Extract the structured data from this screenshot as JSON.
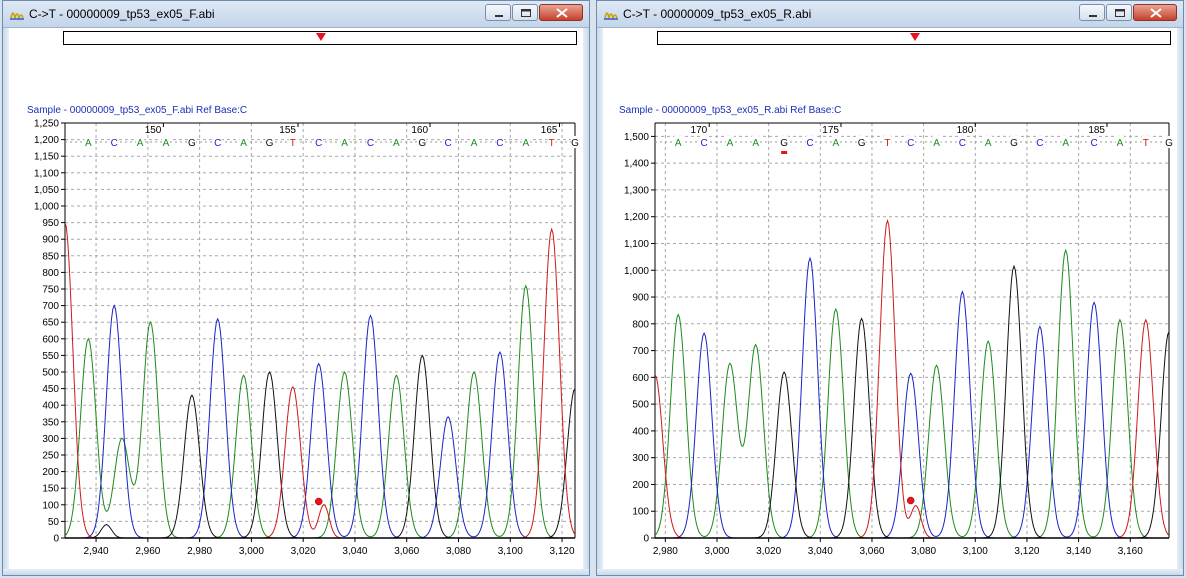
{
  "windows": [
    {
      "title": "C->T - 00000009_tp53_ex05_F.abi",
      "sample_label": "Sample - 00000009_tp53_ex05_F.abi  Ref Base:C",
      "nav_marker_fraction": 0.5,
      "chart_data": {
        "type": "line",
        "xlim": [
          2928,
          3125
        ],
        "ylim": [
          0,
          1250
        ],
        "x_ticks": [
          2940,
          2960,
          2980,
          3000,
          3020,
          3040,
          3060,
          3080,
          3100,
          3120
        ],
        "x_tick_labels": [
          "2,940",
          "2,960",
          "2,980",
          "3,000",
          "3,020",
          "3,040",
          "3,060",
          "3,080",
          "3,100",
          "3,120"
        ],
        "y_ticks": [
          0,
          50,
          100,
          150,
          200,
          250,
          300,
          350,
          400,
          450,
          500,
          550,
          600,
          650,
          700,
          750,
          800,
          850,
          900,
          950,
          1000,
          1050,
          1100,
          1150,
          1200,
          1250
        ],
        "y_tick_labels": [
          "0",
          "50",
          "100",
          "150",
          "200",
          "250",
          "300",
          "350",
          "400",
          "450",
          "500",
          "550",
          "600",
          "650",
          "700",
          "750",
          "800",
          "850",
          "900",
          "950",
          "1,000",
          "1,050",
          "1,100",
          "1,150",
          "1,200",
          "1,250"
        ],
        "bases": {
          "letters": [
            "A",
            "C",
            "A",
            "A",
            "G",
            "C",
            "A",
            "G",
            "T",
            "C",
            "A",
            "C",
            "A",
            "G",
            "C",
            "A",
            "C",
            "A",
            "T",
            "G"
          ],
          "x": [
            2937,
            2947,
            2957,
            2967,
            2977,
            2987,
            2997,
            3007,
            3016,
            3026,
            3036,
            3046,
            3056,
            3066,
            3076,
            3086,
            3096,
            3106,
            3116,
            3125
          ]
        },
        "position_labels": [
          "150",
          "155",
          "160",
          "165"
        ],
        "position_x": [
          2966,
          3018,
          3069,
          3119
        ],
        "variant_point": {
          "x": 3026,
          "y": 110
        },
        "series": [
          {
            "name": "A",
            "color": "#1e8a1e",
            "peaks": [
              [
                2937,
                600,
                3
              ],
              [
                2961,
                650,
                3
              ],
              [
                2950,
                300,
                3
              ],
              [
                2997,
                490,
                3
              ],
              [
                3036,
                500,
                3
              ],
              [
                3056,
                490,
                3
              ],
              [
                3086,
                500,
                3
              ],
              [
                3106,
                760,
                3
              ]
            ]
          },
          {
            "name": "C",
            "color": "#1a23c8",
            "peaks": [
              [
                2947,
                700,
                3
              ],
              [
                2987,
                660,
                3
              ],
              [
                3026,
                525,
                3
              ],
              [
                3046,
                670,
                3
              ],
              [
                3076,
                365,
                3
              ],
              [
                3096,
                560,
                3
              ]
            ]
          },
          {
            "name": "G",
            "color": "#111111",
            "peaks": [
              [
                2977,
                430,
                3
              ],
              [
                3007,
                500,
                3
              ],
              [
                3066,
                550,
                3
              ],
              [
                3125,
                450,
                3
              ],
              [
                2944,
                40,
                2
              ]
            ]
          },
          {
            "name": "T",
            "color": "#d01818",
            "peaks": [
              [
                2928,
                950,
                3
              ],
              [
                3016,
                455,
                3
              ],
              [
                3116,
                930,
                3
              ],
              [
                3028,
                100,
                2
              ]
            ]
          }
        ]
      }
    },
    {
      "title": "C->T - 00000009_tp53_ex05_R.abi",
      "sample_label": "Sample - 00000009_tp53_ex05_R.abi  Ref Base:C",
      "nav_marker_fraction": 0.5,
      "chart_data": {
        "type": "line",
        "xlim": [
          2976,
          3175
        ],
        "ylim": [
          0,
          1550
        ],
        "x_ticks": [
          2980,
          3000,
          3020,
          3040,
          3060,
          3080,
          3100,
          3120,
          3140,
          3160
        ],
        "x_tick_labels": [
          "2,980",
          "3,000",
          "3,020",
          "3,040",
          "3,060",
          "3,080",
          "3,100",
          "3,120",
          "3,140",
          "3,160"
        ],
        "y_ticks": [
          0,
          100,
          200,
          300,
          400,
          500,
          600,
          700,
          800,
          900,
          1000,
          1100,
          1200,
          1300,
          1400,
          1500
        ],
        "y_tick_labels": [
          "0",
          "100",
          "200",
          "300",
          "400",
          "500",
          "600",
          "700",
          "800",
          "900",
          "1,000",
          "1,100",
          "1,200",
          "1,300",
          "1,400",
          "1,500"
        ],
        "bases": {
          "letters": [
            "A",
            "C",
            "A",
            "A",
            "G",
            "C",
            "A",
            "G",
            "T",
            "C",
            "A",
            "C",
            "A",
            "G",
            "C",
            "A",
            "C",
            "A",
            "T",
            "G"
          ],
          "x": [
            2985,
            2995,
            3005,
            3015,
            3026,
            3036,
            3046,
            3056,
            3066,
            3075,
            3085,
            3095,
            3105,
            3115,
            3125,
            3135,
            3146,
            3156,
            3166,
            3175
          ]
        },
        "position_labels": [
          "170",
          "175",
          "180",
          "185"
        ],
        "position_x": [
          2997,
          3048,
          3100,
          3151
        ],
        "highlight_base_index": 4,
        "variant_point": {
          "x": 3075,
          "y": 140
        },
        "series": [
          {
            "name": "A",
            "color": "#1e8a1e",
            "peaks": [
              [
                2985,
                835,
                3
              ],
              [
                3005,
                650,
                3
              ],
              [
                3015,
                720,
                3
              ],
              [
                3046,
                855,
                3
              ],
              [
                3085,
                645,
                3
              ],
              [
                3105,
                735,
                3
              ],
              [
                3135,
                1075,
                3
              ],
              [
                3156,
                815,
                3
              ]
            ]
          },
          {
            "name": "C",
            "color": "#1a23c8",
            "peaks": [
              [
                2995,
                765,
                3
              ],
              [
                3036,
                1045,
                3
              ],
              [
                3075,
                615,
                3
              ],
              [
                3095,
                920,
                3
              ],
              [
                3125,
                790,
                3
              ],
              [
                3146,
                880,
                3
              ]
            ]
          },
          {
            "name": "G",
            "color": "#111111",
            "peaks": [
              [
                3026,
                620,
                3
              ],
              [
                3056,
                820,
                3
              ],
              [
                3115,
                1015,
                3
              ],
              [
                3175,
                770,
                3
              ]
            ]
          },
          {
            "name": "T",
            "color": "#d01818",
            "peaks": [
              [
                2976,
                610,
                3
              ],
              [
                3066,
                1185,
                3
              ],
              [
                3166,
                815,
                3
              ],
              [
                3077,
                120,
                2
              ]
            ]
          }
        ]
      }
    }
  ]
}
